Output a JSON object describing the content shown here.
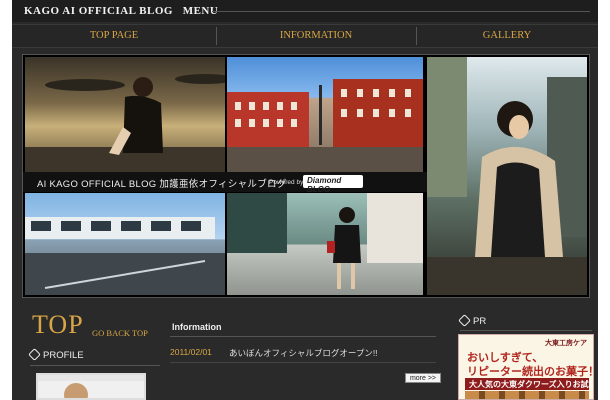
{
  "header": {
    "title": "KAGO AI OFFICIAL BLOG",
    "menu_label": "MENU"
  },
  "nav": {
    "items": [
      {
        "label": "TOP PAGE"
      },
      {
        "label": "INFORMATION"
      },
      {
        "label": "GALLERY"
      }
    ]
  },
  "banner": {
    "caption": "AI KAGO OFFICIAL BLOG 加護亜依オフィシャルブログ",
    "powered_by": "Powered by",
    "sponsor_logo": "Diamond BLOG"
  },
  "main": {
    "top_heading": "TOP",
    "go_back_top": "GO BACK TOP",
    "information": {
      "heading": "Information",
      "entries": [
        {
          "date": "2011/02/01",
          "text": "あいぼんオフィシャルブログオープン!!"
        }
      ],
      "more_label": "more >>"
    }
  },
  "sidebar": {
    "profile_heading": "PROFILE"
  },
  "pr": {
    "heading": "PR",
    "ad": {
      "brand": "大東工房ケア",
      "line1": "おいしすぎて、",
      "line2": "リピーター続出のお菓子！",
      "line3": "大人気の大東ダクワーズ入りお試しセット"
    }
  },
  "colors": {
    "accent": "#d9a646",
    "background": "#2a2a2a"
  }
}
